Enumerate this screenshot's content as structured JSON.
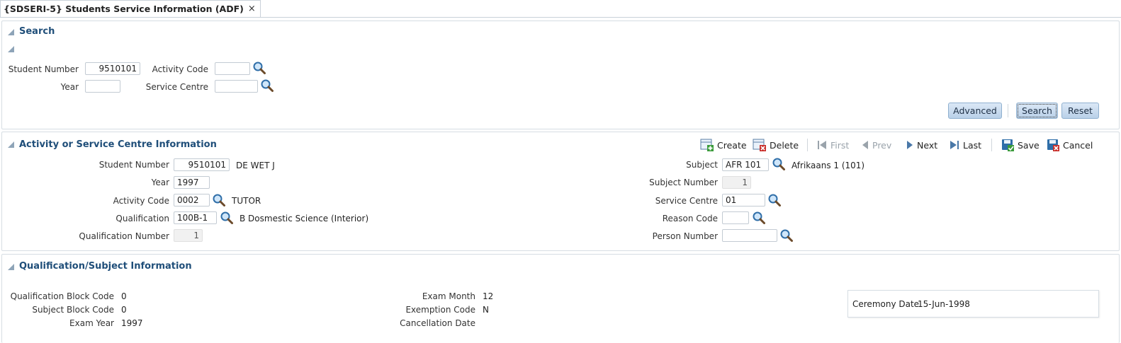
{
  "tab": {
    "title": "{SDSERI-5} Students Service Information (ADF)",
    "close": "×"
  },
  "search": {
    "title": "Search",
    "student_number_label": "Student Number",
    "student_number_value": "9510101",
    "activity_code_label": "Activity Code",
    "activity_code_value": "",
    "year_label": "Year",
    "year_value": "",
    "service_centre_label": "Service Centre",
    "service_centre_value": "",
    "advanced_label": "Advanced",
    "search_label": "Search",
    "reset_label": "Reset"
  },
  "activity": {
    "title": "Activity or Service Centre Information",
    "toolbar": {
      "create": "Create",
      "delete": "Delete",
      "first": "First",
      "prev": "Prev",
      "next": "Next",
      "last": "Last",
      "save": "Save",
      "cancel": "Cancel"
    },
    "student_number_label": "Student Number",
    "student_number_value": "9510101",
    "student_name": "DE WET  J",
    "year_label": "Year",
    "year_value": "1997",
    "activity_code_label": "Activity Code",
    "activity_code_value": "0002",
    "activity_desc": "TUTOR",
    "qualification_label": "Qualification",
    "qualification_value": "100B-1",
    "qualification_desc": "B Dosmestic Science (Interior)",
    "qualification_number_label": "Qualification Number",
    "qualification_number_value": "1",
    "subject_label": "Subject",
    "subject_value": "AFR 101",
    "subject_desc": "Afrikaans 1 (101)",
    "subject_number_label": "Subject Number",
    "subject_number_value": "1",
    "service_centre_label": "Service Centre",
    "service_centre_value": "01",
    "reason_code_label": "Reason Code",
    "reason_code_value": "",
    "person_number_label": "Person Number",
    "person_number_value": ""
  },
  "qualification": {
    "title": "Qualification/Subject Information",
    "qual_block_label": "Qualification Block Code",
    "qual_block_value": "0",
    "subj_block_label": "Subject Block Code",
    "subj_block_value": "0",
    "exam_year_label": "Exam Year",
    "exam_year_value": "1997",
    "exam_month_label": "Exam Month",
    "exam_month_value": "12",
    "exemption_label": "Exemption Code",
    "exemption_value": "N",
    "cancellation_label": "Cancellation Date",
    "cancellation_value": "",
    "ceremony_label": "Ceremony Date",
    "ceremony_value": "15-Jun-1998"
  },
  "colors": {
    "title": "#1f4e79",
    "button_top": "#dbe8f6",
    "button_bottom": "#b9d0e8"
  }
}
